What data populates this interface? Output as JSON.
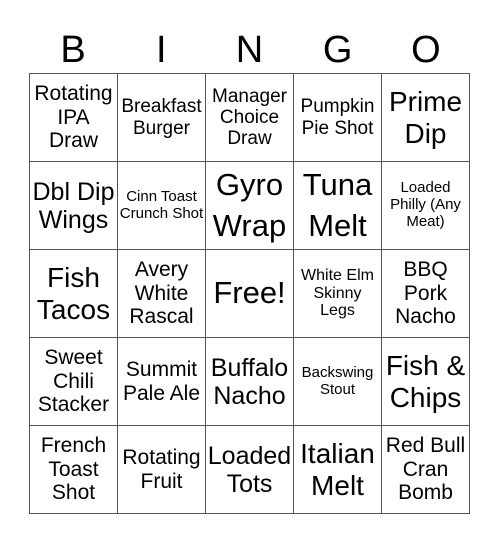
{
  "header": [
    "B",
    "I",
    "N",
    "G",
    "O"
  ],
  "cells": [
    {
      "text": "Rotating IPA Draw",
      "size": "s20"
    },
    {
      "text": "Breakfast Burger",
      "size": "s18"
    },
    {
      "text": "Manager Choice Draw",
      "size": "s18"
    },
    {
      "text": "Pumpkin Pie Shot",
      "size": "s18"
    },
    {
      "text": "Prime Dip",
      "size": "s28"
    },
    {
      "text": "Dbl Dip Wings",
      "size": "s24"
    },
    {
      "text": "Cinn Toast Crunch Shot",
      "size": "s15"
    },
    {
      "text": "Gyro Wrap",
      "size": "s32"
    },
    {
      "text": "Tuna Melt",
      "size": "s32"
    },
    {
      "text": "Loaded Philly (Any Meat)",
      "size": "s15"
    },
    {
      "text": "Fish Tacos",
      "size": "s28"
    },
    {
      "text": "Avery White Rascal",
      "size": "s20"
    },
    {
      "text": "Free!",
      "size": "s32"
    },
    {
      "text": "White Elm Skinny Legs",
      "size": "s16"
    },
    {
      "text": "BBQ Pork Nacho",
      "size": "s20"
    },
    {
      "text": "Sweet Chili Stacker",
      "size": "s20"
    },
    {
      "text": "Summit Pale Ale",
      "size": "s20"
    },
    {
      "text": "Buffalo Nacho",
      "size": "s24"
    },
    {
      "text": "Backswing Stout",
      "size": "s15"
    },
    {
      "text": "Fish & Chips",
      "size": "s28"
    },
    {
      "text": "French Toast Shot",
      "size": "s20"
    },
    {
      "text": "Rotating Fruit",
      "size": "s20"
    },
    {
      "text": "Loaded Tots",
      "size": "s24"
    },
    {
      "text": "Italian Melt",
      "size": "s28"
    },
    {
      "text": "Red Bull Cran Bomb",
      "size": "s20"
    }
  ]
}
